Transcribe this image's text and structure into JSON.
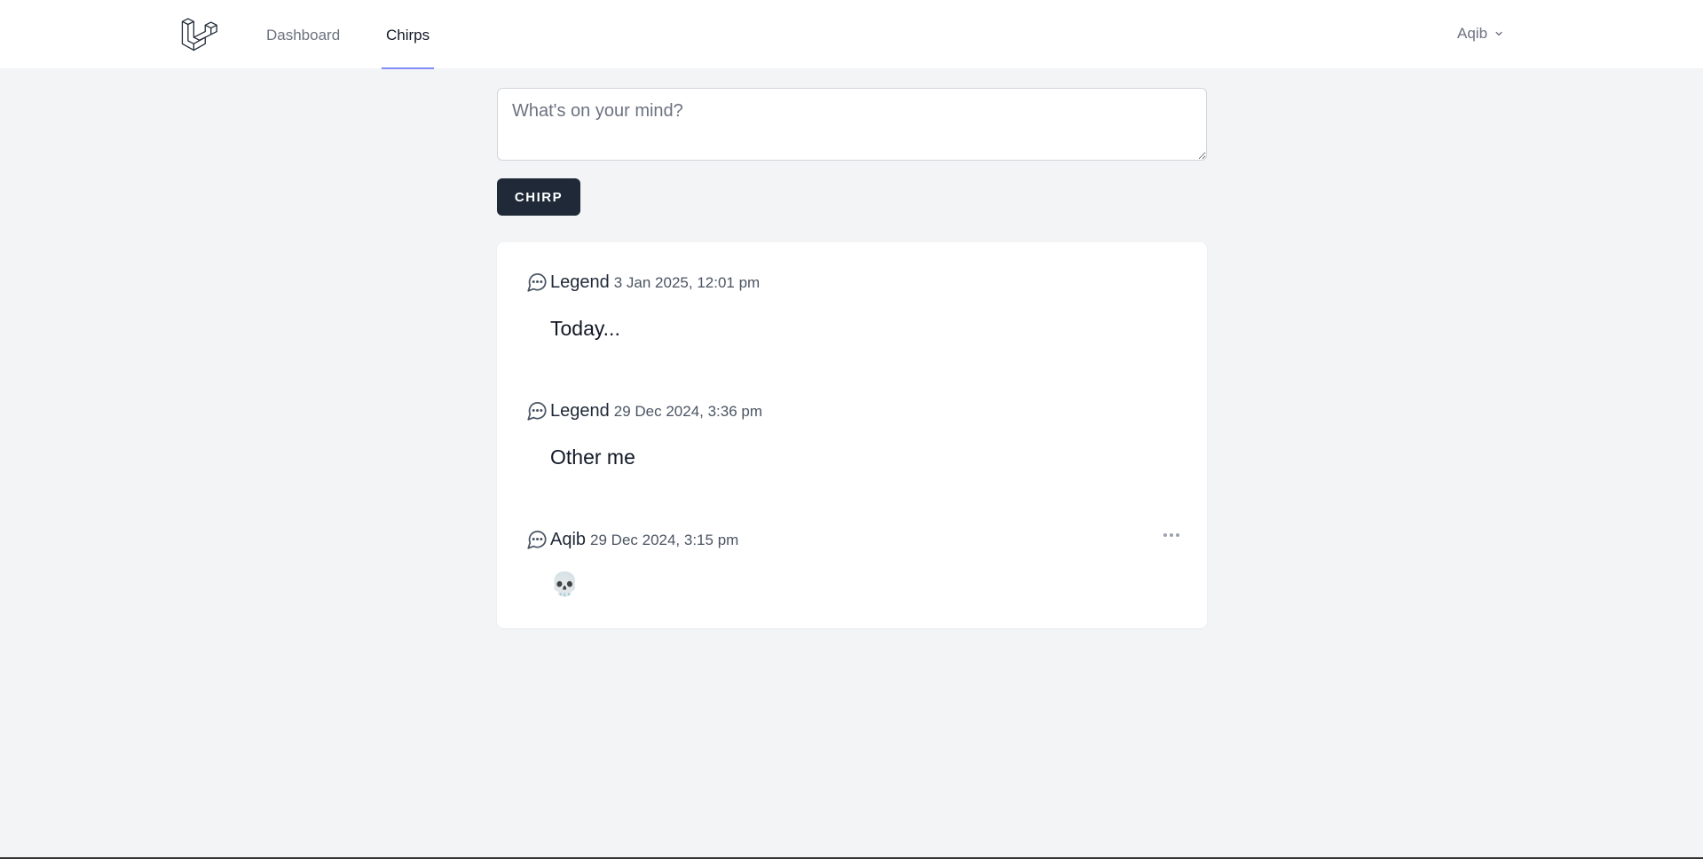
{
  "nav": {
    "logo_icon": "laravel-logo-icon",
    "links": [
      {
        "label": "Dashboard",
        "active": false
      },
      {
        "label": "Chirps",
        "active": true
      }
    ],
    "user": {
      "name": "Aqib",
      "icon": "chevron-down-icon"
    }
  },
  "composer": {
    "placeholder": "What's on your mind?",
    "value": "",
    "submit_label": "Chirp"
  },
  "chirps": [
    {
      "author": "Legend",
      "time": "3 Jan 2025, 12:01 pm",
      "message": "Today...",
      "icon": "chat-bubble-icon",
      "has_menu": false
    },
    {
      "author": "Legend",
      "time": "29 Dec 2024, 3:36 pm",
      "message": "Other me",
      "icon": "chat-bubble-icon",
      "has_menu": false
    },
    {
      "author": "Aqib",
      "time": "29 Dec 2024, 3:15 pm",
      "message": "💀",
      "icon": "chat-bubble-icon",
      "has_menu": true
    }
  ],
  "colors": {
    "background": "#f3f4f6",
    "button": "#1f2937",
    "active_tab_underline": "#818cf8"
  }
}
